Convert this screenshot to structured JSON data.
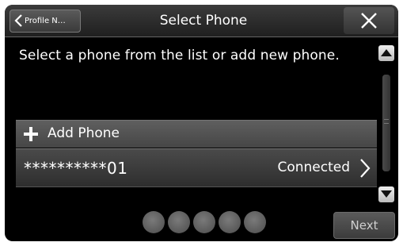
{
  "header": {
    "back_label": "Profile N…",
    "title": "Select Phone"
  },
  "instruction": "Select a phone from the list or add new phone.",
  "list": {
    "add_label": "Add Phone",
    "phones": [
      {
        "name": "**********01",
        "status": "Connected"
      }
    ]
  },
  "pager": {
    "pages": 5
  },
  "footer": {
    "next_label": "Next"
  },
  "icons": {
    "back": "chevron-left-icon",
    "close": "close-icon",
    "add": "plus-icon",
    "row": "chevron-right-icon",
    "up": "arrow-up-icon",
    "down": "arrow-down-icon"
  }
}
